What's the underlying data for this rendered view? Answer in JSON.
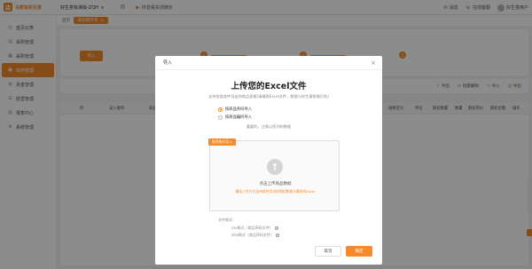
{
  "app": {
    "logo_mark": "店",
    "logo_text": "马帮有好生意",
    "store": "好生意标准版-ZQH",
    "notice": "抖音看实训演示",
    "top_right": {
      "msg_label": "消息",
      "online": "在线客服",
      "user": "好生意用户"
    }
  },
  "sidebar": {
    "items": [
      {
        "icon": "◎",
        "label": "首页仪表"
      },
      {
        "icon": "▤",
        "label": "采购管理"
      },
      {
        "icon": "▦",
        "label": "采购管理"
      },
      {
        "icon": "▣",
        "label": "库存管理",
        "active": true
      },
      {
        "icon": "◍",
        "label": "资金管理"
      },
      {
        "icon": "☰",
        "label": "经营管理"
      },
      {
        "icon": "▥",
        "label": "报表中心"
      },
      {
        "icon": "⚙",
        "label": "系统管理"
      }
    ]
  },
  "breadcrumb": {
    "home": "首页",
    "tab": "期初库存单"
  },
  "steps": {
    "badge": "导入",
    "items": [
      {
        "num": "1"
      },
      {
        "num": "2"
      },
      {
        "num": "3"
      }
    ]
  },
  "toolbar": {
    "items": [
      {
        "icon": "⇩",
        "label": "导出"
      },
      {
        "icon": "⊕",
        "label": "批量删除"
      },
      {
        "icon": "↻",
        "label": "导入"
      },
      {
        "icon": "▤",
        "label": "导出"
      }
    ]
  },
  "table": {
    "headers": [
      "序",
      "录入顺序",
      "商品",
      "规格型号",
      "单位",
      "期初数量",
      "数量",
      "期初单价",
      "期初金额",
      "操作"
    ]
  },
  "dialog": {
    "header": "导入",
    "title": "上传您的Excel文件",
    "subtitle": "支持各类软件导出的商品表格(请确保Excel文件，数据与好生意智能识别)",
    "radio_options": [
      {
        "label": "按商品条码导入",
        "selected": true
      },
      {
        "label": "按商品编码导入",
        "selected": false
      }
    ],
    "hint": "重要的，注意以您列的数据",
    "dropzone": {
      "tag": "推荐格式导入",
      "main": "点击上传商品数据",
      "note": "最佳上传方式支持软件导出的期初数据计算好的Excel"
    },
    "formats": {
      "title": "文件格式：",
      "items": [
        "csv格式（商品序码文件）",
        "xlsx格式（商品序码文件）"
      ]
    },
    "cancel": "取消",
    "ok": "确定"
  }
}
